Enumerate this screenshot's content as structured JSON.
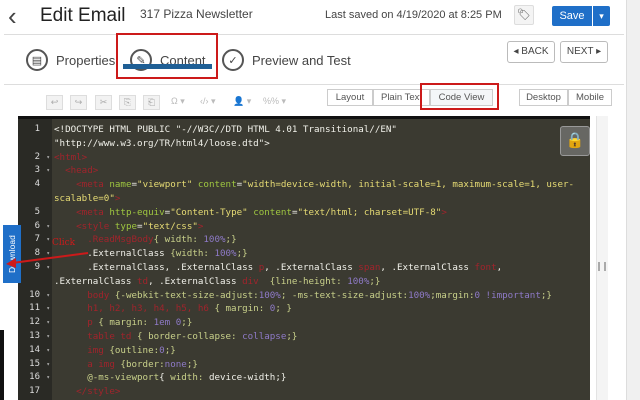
{
  "header": {
    "back_icon": "chevron-left-icon",
    "title": "Edit Email",
    "subtitle": "317 Pizza Newsletter",
    "last_saved": "Last saved on 4/19/2020 at 8:25 PM",
    "save_label": "Save",
    "save_dropdown": "▾",
    "tag_icon": "tag-icon"
  },
  "tabs": [
    {
      "label": "Properties",
      "icon": "properties-icon"
    },
    {
      "label": "Content",
      "icon": "pencil-icon"
    },
    {
      "label": "Preview and Test",
      "icon": "check-icon"
    }
  ],
  "nav": {
    "back": "◂ BACK",
    "next": "NEXT ▸"
  },
  "toolbar": {
    "tools": [
      "↩",
      "↪",
      "✂",
      "⎘",
      "⎗"
    ],
    "dropdowns": [
      "Ω ▾",
      "‹/› ▾",
      "👤 ▾",
      "%% ▾"
    ]
  },
  "view_modes": [
    "Layout",
    "Plain Text",
    "Code View"
  ],
  "devices": [
    "Desktop",
    "Mobile"
  ],
  "annotation": {
    "click": "Click"
  },
  "download_tab": "Download",
  "colors": {
    "accent": "#1f6fc8",
    "highlight": "#cc1a1a",
    "editor_bg": "#3b3a31"
  },
  "code": [
    {
      "n": "1",
      "f": false,
      "tokens": [
        [
          "p",
          "<!DOCTYPE HTML PUBLIC \"-//W3C//DTD HTML 4.01 Transitional//EN\" \"http://www.w3.org/TR/html4/loose.dtd\">"
        ]
      ]
    },
    {
      "n": "2",
      "f": true,
      "tokens": [
        [
          "k",
          "<html>"
        ]
      ]
    },
    {
      "n": "3",
      "f": true,
      "tokens": [
        [
          "k",
          "  <head>"
        ]
      ]
    },
    {
      "n": "4",
      "f": false,
      "tokens": [
        [
          "k",
          "    <meta "
        ],
        [
          "a",
          "name"
        ],
        [
          "p",
          "="
        ],
        [
          "s",
          "\"viewport\" "
        ],
        [
          "a",
          "content"
        ],
        [
          "p",
          "="
        ],
        [
          "s",
          "\"width=device-width, initial-scale=1, maximum-scale=1, user-scalable=0\""
        ],
        [
          "k",
          ">"
        ]
      ]
    },
    {
      "n": "5",
      "f": false,
      "tokens": [
        [
          "k",
          "    <meta "
        ],
        [
          "a",
          "http-equiv"
        ],
        [
          "p",
          "="
        ],
        [
          "s",
          "\"Content-Type\" "
        ],
        [
          "a",
          "content"
        ],
        [
          "p",
          "="
        ],
        [
          "s",
          "\"text/html; charset=UTF-8\""
        ],
        [
          "k",
          ">"
        ]
      ]
    },
    {
      "n": "6",
      "f": true,
      "tokens": [
        [
          "k",
          "    <style "
        ],
        [
          "a",
          "type"
        ],
        [
          "p",
          "="
        ],
        [
          "s",
          "\"text/css\""
        ],
        [
          "k",
          ">"
        ]
      ]
    },
    {
      "n": "7",
      "f": true,
      "tokens": [
        [
          "k",
          "      .ReadMsgBody"
        ],
        [
          "v",
          "{ width: "
        ],
        [
          "n",
          "100%"
        ],
        [
          "v",
          ";}"
        ]
      ]
    },
    {
      "n": "8",
      "f": true,
      "tokens": [
        [
          "p",
          "      .ExternalClass "
        ],
        [
          "v",
          "{width: "
        ],
        [
          "n",
          "100%"
        ],
        [
          "v",
          ";}"
        ]
      ]
    },
    {
      "n": "9",
      "f": true,
      "tokens": [
        [
          "p",
          "      .ExternalClass, .ExternalClass "
        ],
        [
          "k",
          "p"
        ],
        [
          "p",
          ", .ExternalClass "
        ],
        [
          "k",
          "span"
        ],
        [
          "p",
          ", .ExternalClass "
        ],
        [
          "k",
          "font"
        ],
        [
          "p",
          ", .ExternalClass "
        ],
        [
          "k",
          "td"
        ],
        [
          "p",
          ", .ExternalClass "
        ],
        [
          "k",
          "div"
        ],
        [
          "v",
          "  {line-height: "
        ],
        [
          "n",
          "100%"
        ],
        [
          "v",
          ";}"
        ]
      ]
    },
    {
      "n": "10",
      "f": true,
      "tokens": [
        [
          "k",
          "      body "
        ],
        [
          "v",
          "{-webkit-text-size-adjust:"
        ],
        [
          "n",
          "100%"
        ],
        [
          "v",
          "; -ms-text-size-adjust:"
        ],
        [
          "n",
          "100%"
        ],
        [
          "v",
          ";margin:"
        ],
        [
          "n",
          "0 !important"
        ],
        [
          "v",
          ";}"
        ]
      ]
    },
    {
      "n": "11",
      "f": true,
      "tokens": [
        [
          "k",
          "      h1, h2, h3, h4, h5, h6 "
        ],
        [
          "v",
          "{ margin: "
        ],
        [
          "n",
          "0"
        ],
        [
          "v",
          "; }"
        ]
      ]
    },
    {
      "n": "12",
      "f": true,
      "tokens": [
        [
          "k",
          "      p "
        ],
        [
          "v",
          "{ margin: "
        ],
        [
          "n",
          "1em 0"
        ],
        [
          "v",
          ";}"
        ]
      ]
    },
    {
      "n": "13",
      "f": true,
      "tokens": [
        [
          "k",
          "      table td "
        ],
        [
          "v",
          "{ border-collapse: "
        ],
        [
          "n",
          "collapse"
        ],
        [
          "v",
          ";}"
        ]
      ]
    },
    {
      "n": "14",
      "f": true,
      "tokens": [
        [
          "k",
          "      img "
        ],
        [
          "v",
          "{outline:"
        ],
        [
          "n",
          "0"
        ],
        [
          "v",
          ";}"
        ]
      ]
    },
    {
      "n": "15",
      "f": true,
      "tokens": [
        [
          "k",
          "      a img "
        ],
        [
          "v",
          "{border:"
        ],
        [
          "n",
          "none"
        ],
        [
          "v",
          ";}"
        ]
      ]
    },
    {
      "n": "16",
      "f": true,
      "tokens": [
        [
          "v",
          "      @-ms-viewport"
        ],
        [
          "p",
          "{ "
        ],
        [
          "v",
          "width: "
        ],
        [
          "p",
          "device-width;}"
        ]
      ]
    },
    {
      "n": "17",
      "f": false,
      "tokens": [
        [
          "k",
          "    </style>"
        ]
      ]
    }
  ]
}
